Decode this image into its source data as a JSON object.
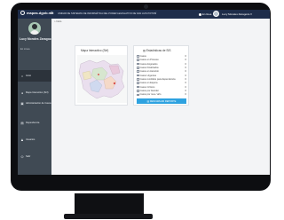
{
  "topbar": {
    "brand": "mapas.dgob.mx",
    "title": "UNIDAD DE SISTEMAS DE INFORMÁTICA DEL PODER LEGISLATIVO DE SAN LUIS POTOSÍ",
    "status": "En línea",
    "user": "Lucy Morales Zaragoza"
  },
  "sidebar": {
    "name": "Lucy Morales Zaragoza",
    "role": "En Línea",
    "items": [
      {
        "label": "Inicio",
        "icon": "home-icon"
      },
      {
        "label": "Mapa Interactivo (Sirf)",
        "icon": "map-marker-icon"
      },
      {
        "label": "Administración de Casos",
        "icon": "folder-icon"
      },
      {
        "label": "Dependencia",
        "icon": "building-icon"
      },
      {
        "label": "Usuarios",
        "icon": "users-icon"
      },
      {
        "label": "Salir",
        "icon": "power-icon"
      }
    ]
  },
  "breadcrumb": "Inicio",
  "map_card": {
    "title": "Mapa Interactivo (Sirf)"
  },
  "stats_card": {
    "title": "Estadísticas de SIS",
    "rows": [
      {
        "label": "Casos",
        "value": "0"
      },
      {
        "label": "Casos en Proceso",
        "value": "0"
      },
      {
        "label": "Casos Asignados",
        "value": "0"
      },
      {
        "label": "Casos Finalizados",
        "value": "0"
      },
      {
        "label": "Casos en Atención",
        "value": "0"
      },
      {
        "label": "Casos Urgentes",
        "value": "0"
      },
      {
        "label": "Casos remitidos para dependencia",
        "value": "0"
      },
      {
        "label": "Casos en Espera",
        "value": "0"
      },
      {
        "label": "Casos Críticos",
        "value": "0"
      },
      {
        "label": "Casos por Atender",
        "value": "0"
      },
      {
        "label": "Casos por mes / año",
        "value": "0"
      }
    ],
    "button_label": "DESCARGAR REPORTE"
  },
  "colors": {
    "topbar": "#1e2d4a",
    "sidebar": "#404a54",
    "accent": "#2ea2e0"
  }
}
